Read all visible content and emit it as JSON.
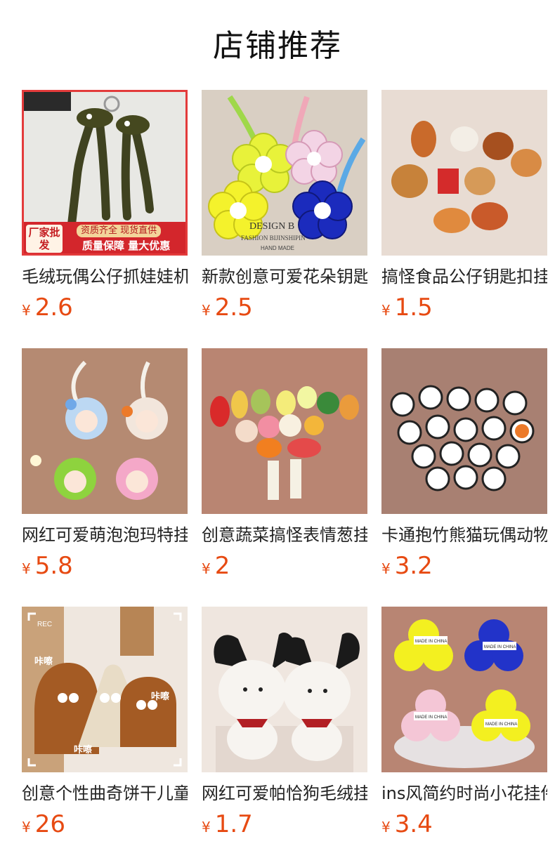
{
  "page": {
    "title": "店铺推荐"
  },
  "products": [
    {
      "name": "毛绒玩偶公仔抓娃娃机钥匙扣挂件",
      "currency": "¥",
      "price": "2.6",
      "banner": {
        "tag": "厂家批发",
        "line1": "资质齐全 现货直供",
        "line2": "质量保障 量大优惠"
      }
    },
    {
      "name": "新款创意可爱花朵钥匙扣挂件",
      "currency": "¥",
      "price": "2.5",
      "watermark": {
        "line1": "DESIGN B",
        "line2": "FASHION BIJINSHIPIN",
        "line3": "HAND MADE"
      }
    },
    {
      "name": "搞怪食品公仔钥匙扣挂件",
      "currency": "¥",
      "price": "1.5"
    },
    {
      "name": "网红可爱萌泡泡玛特挂件",
      "currency": "¥",
      "price": "5.8"
    },
    {
      "name": "创意蔬菜搞怪表情葱挂件",
      "currency": "¥",
      "price": "2"
    },
    {
      "name": "卡通抱竹熊猫玩偶动物挂件",
      "currency": "¥",
      "price": "3.2"
    },
    {
      "name": "创意个性曲奇饼干儿童背包",
      "currency": "¥",
      "price": "26",
      "overlay": {
        "rec": "REC",
        "tag1": "咔嚓",
        "tag2": "咔嚓",
        "tag3": "咔嚓"
      }
    },
    {
      "name": "网红可爱帕恰狗毛绒挂件",
      "currency": "¥",
      "price": "1.7"
    },
    {
      "name": "ins风简约时尚小花挂件",
      "currency": "¥",
      "price": "3.4",
      "labels": [
        "MADE IN CHINA",
        "MADE IN CHINA",
        "MADE IN CHINA",
        "MADE IN CHINA"
      ]
    }
  ],
  "colors": {
    "price": "#e74a12",
    "title": "#111111",
    "banner": "#d3262c"
  }
}
